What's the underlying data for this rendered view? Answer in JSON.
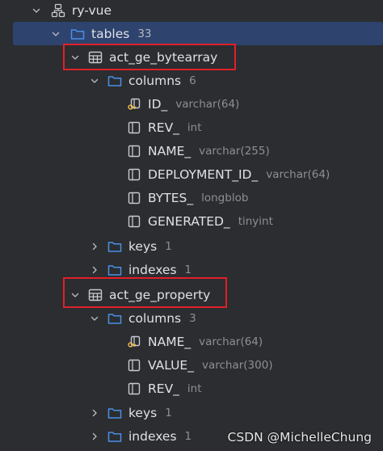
{
  "tree": {
    "datasource": {
      "label": "ry-vue",
      "icon": "datasource-icon"
    },
    "tables_folder": {
      "label": "tables",
      "count": "33",
      "icon": "folder-icon"
    },
    "table1": {
      "label": "act_ge_bytearray",
      "icon": "table-icon",
      "columns_folder": {
        "label": "columns",
        "count": "6"
      },
      "columns": [
        {
          "name": "ID_",
          "type": "varchar(64)",
          "icon": "primary-key-column-icon"
        },
        {
          "name": "REV_",
          "type": "int",
          "icon": "column-icon"
        },
        {
          "name": "NAME_",
          "type": "varchar(255)",
          "icon": "column-icon"
        },
        {
          "name": "DEPLOYMENT_ID_",
          "type": "varchar(64)",
          "icon": "column-icon"
        },
        {
          "name": "BYTES_",
          "type": "longblob",
          "icon": "column-icon"
        },
        {
          "name": "GENERATED_",
          "type": "tinyint",
          "icon": "column-icon"
        }
      ],
      "keys_folder": {
        "label": "keys",
        "count": "1"
      },
      "indexes_folder": {
        "label": "indexes",
        "count": "1"
      }
    },
    "table2": {
      "label": "act_ge_property",
      "icon": "table-icon",
      "columns_folder": {
        "label": "columns",
        "count": "3"
      },
      "columns": [
        {
          "name": "NAME_",
          "type": "varchar(64)",
          "icon": "primary-key-column-icon"
        },
        {
          "name": "VALUE_",
          "type": "varchar(300)",
          "icon": "column-icon"
        },
        {
          "name": "REV_",
          "type": "int",
          "icon": "column-icon"
        }
      ],
      "keys_folder": {
        "label": "keys",
        "count": "1"
      },
      "indexes_folder": {
        "label": "indexes",
        "count": "1"
      }
    }
  },
  "watermark": "CSDN @MichelleChung",
  "colors": {
    "background": "#2b2d30",
    "selection": "#2e436e",
    "folder": "#4a8fe7",
    "highlight_box": "#e0202a"
  }
}
